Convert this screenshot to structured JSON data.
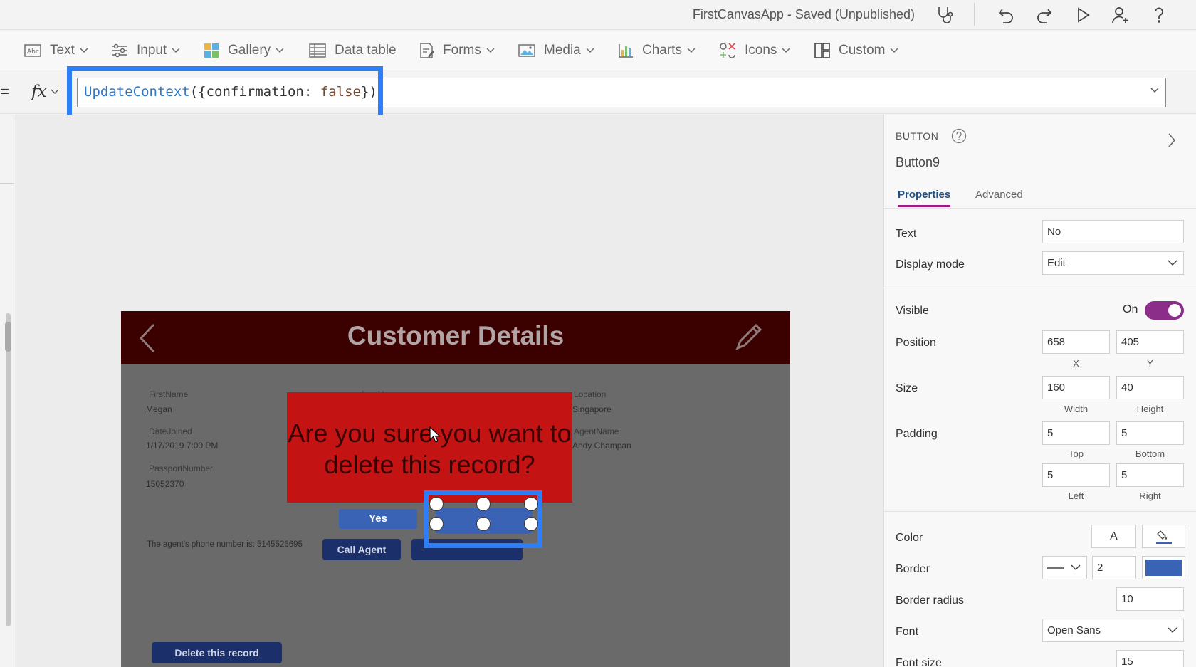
{
  "app": {
    "title": "FirstCanvasApp - Saved (Unpublished)"
  },
  "toolbar": {
    "icons": [
      "stethoscope-icon",
      "undo-icon",
      "redo-icon",
      "play-icon",
      "share-user-icon",
      "help-icon"
    ]
  },
  "insert": {
    "items": [
      {
        "label": "Text",
        "icon": "text-label-icon",
        "dropdown": true
      },
      {
        "label": "Input",
        "icon": "input-sliders-icon",
        "dropdown": true
      },
      {
        "label": "Gallery",
        "icon": "gallery-icon",
        "dropdown": true
      },
      {
        "label": "Data table",
        "icon": "data-table-icon",
        "dropdown": false
      },
      {
        "label": "Forms",
        "icon": "forms-icon",
        "dropdown": true
      },
      {
        "label": "Media",
        "icon": "media-icon",
        "dropdown": true
      },
      {
        "label": "Charts",
        "icon": "charts-icon",
        "dropdown": true
      },
      {
        "label": "Icons",
        "icon": "icons-icon",
        "dropdown": true
      },
      {
        "label": "Custom",
        "icon": "custom-icon",
        "dropdown": true
      }
    ]
  },
  "formula": {
    "eq": "=",
    "fx": "fx",
    "fn": "UpdateContext",
    "open": "({confirmation: ",
    "value": "false",
    "close": "})"
  },
  "screen": {
    "title": "Customer Details",
    "fields": {
      "firstname_label": "FirstName",
      "firstname_value": "Megan",
      "lastname_label": "LastName",
      "location_label": "Location",
      "location_value": "Singapore",
      "datejoined_label": "DateJoined",
      "datejoined_value": "1/17/2019 7:00 PM",
      "agentname_label": "AgentName",
      "agentname_value": "Andy Champan",
      "passport_label": "PassportNumber",
      "passport_value": "15052370"
    },
    "popup_text": "Are you sure you want to delete this record?",
    "yes_label": "Yes",
    "no_label": "No",
    "phone_text": "The agent's phone number is: 5145526695",
    "call_agent_label": "Call Agent",
    "delete_label": "Delete this record"
  },
  "props": {
    "type": "BUTTON",
    "name": "Button9",
    "tabs": [
      "Properties",
      "Advanced"
    ],
    "active_tab": "Properties",
    "text_label": "Text",
    "text_value": "No",
    "display_mode_label": "Display mode",
    "display_mode_value": "Edit",
    "visible_label": "Visible",
    "visible_state": "On",
    "position_label": "Position",
    "position_x": "658",
    "position_y": "405",
    "x_label": "X",
    "y_label": "Y",
    "size_label": "Size",
    "size_width": "160",
    "size_height": "40",
    "width_label": "Width",
    "height_label": "Height",
    "padding_label": "Padding",
    "padding_top": "5",
    "padding_bottom": "5",
    "padding_left": "5",
    "padding_right": "5",
    "top_label": "Top",
    "bottom_label": "Bottom",
    "left_label": "Left",
    "right_label": "Right",
    "color_label": "Color",
    "color_text_glyph": "A",
    "border_label": "Border",
    "border_width": "2",
    "border_color": "#3a63b6",
    "border_radius_label": "Border radius",
    "border_radius_value": "10",
    "font_label": "Font",
    "font_value": "Open Sans",
    "font_size_label": "Font size",
    "font_size_value": "15"
  },
  "colors": {
    "header": "#3b0000",
    "popup": "#c31313",
    "button_blue": "#3a63b6",
    "selection": "#2d7ff9",
    "toggle_on": "#8a2e8a"
  }
}
